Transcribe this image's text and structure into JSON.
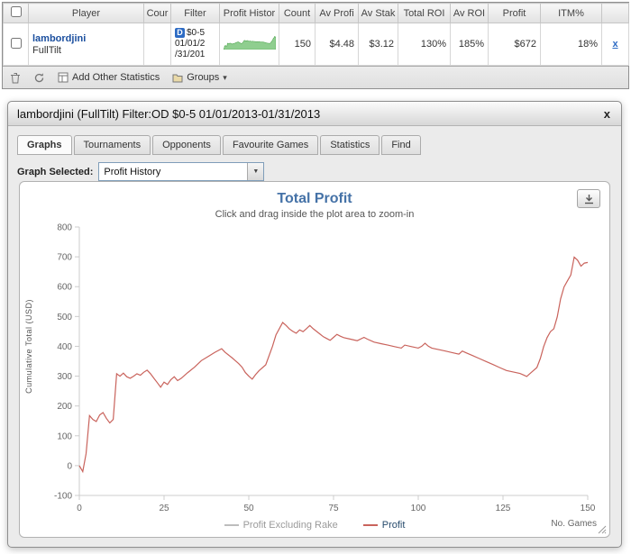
{
  "table": {
    "headers": [
      "",
      "Player",
      "Cour",
      "Filter",
      "Profit Histor",
      "Count",
      "Av Profi",
      "Av Stak",
      "Total ROI",
      "Av ROI",
      "Profit",
      "ITM%",
      ""
    ],
    "row": {
      "player": "lambordjini",
      "site": "FullTilt",
      "filter_badge": "D",
      "filter_line1": "$0-5",
      "filter_line2": "01/01/2",
      "filter_line3": "/31/201",
      "count": "150",
      "av_profit": "$4.48",
      "av_stake": "$3.12",
      "total_roi": "130%",
      "av_roi": "185%",
      "profit": "$672",
      "itm": "18%",
      "remove_label": "x",
      "sparkline_color": "#8fce8f",
      "sparkline_stroke": "#57a957"
    },
    "toolbar": {
      "add_other_statistics": "Add Other Statistics",
      "groups": "Groups",
      "groups_caret": "▾"
    }
  },
  "dialog": {
    "title": "lambordjini (FullTilt) Filter:OD $0-5 01/01/2013-01/31/2013",
    "close_label": "x",
    "tabs": [
      "Graphs",
      "Tournaments",
      "Opponents",
      "Favourite Games",
      "Statistics",
      "Find"
    ],
    "graph_selected_label": "Graph Selected:",
    "graph_selected_value": "Profit History"
  },
  "chart_data": {
    "type": "line",
    "title": "Total Profit",
    "subtitle": "Click and drag inside the plot area to zoom-in",
    "ylabel": "Cumulative Total (USD)",
    "xlabel": "No. Games",
    "xlim": [
      0,
      150
    ],
    "ylim": [
      -100,
      800
    ],
    "xticks": [
      0,
      25,
      50,
      75,
      100,
      125,
      150
    ],
    "yticks": [
      -100,
      0,
      100,
      200,
      300,
      400,
      500,
      600,
      700,
      800
    ],
    "grid": false,
    "legend_position": "bottom",
    "legend": [
      {
        "name": "Profit Excluding Rake",
        "color": "#bdbdbd",
        "label_color": "#9a9a9a",
        "disabled": true
      },
      {
        "name": "Profit",
        "color": "#c9635c",
        "label_color": "#274b6d",
        "disabled": false
      }
    ],
    "series": [
      {
        "name": "Profit",
        "color": "#c9635c",
        "points": [
          [
            0,
            0
          ],
          [
            1,
            -20
          ],
          [
            2,
            40
          ],
          [
            3,
            168
          ],
          [
            4,
            155
          ],
          [
            5,
            148
          ],
          [
            6,
            170
          ],
          [
            7,
            178
          ],
          [
            8,
            158
          ],
          [
            9,
            143
          ],
          [
            10,
            155
          ],
          [
            11,
            308
          ],
          [
            12,
            300
          ],
          [
            13,
            310
          ],
          [
            14,
            298
          ],
          [
            15,
            293
          ],
          [
            16,
            300
          ],
          [
            17,
            308
          ],
          [
            18,
            303
          ],
          [
            19,
            313
          ],
          [
            20,
            320
          ],
          [
            21,
            308
          ],
          [
            22,
            293
          ],
          [
            23,
            278
          ],
          [
            24,
            263
          ],
          [
            25,
            280
          ],
          [
            26,
            272
          ],
          [
            27,
            288
          ],
          [
            28,
            298
          ],
          [
            29,
            285
          ],
          [
            30,
            292
          ],
          [
            32,
            312
          ],
          [
            34,
            330
          ],
          [
            36,
            352
          ],
          [
            38,
            366
          ],
          [
            40,
            380
          ],
          [
            42,
            392
          ],
          [
            43,
            380
          ],
          [
            44,
            371
          ],
          [
            45,
            362
          ],
          [
            46,
            352
          ],
          [
            47,
            342
          ],
          [
            48,
            330
          ],
          [
            49,
            312
          ],
          [
            50,
            300
          ],
          [
            51,
            290
          ],
          [
            52,
            305
          ],
          [
            53,
            318
          ],
          [
            55,
            338
          ],
          [
            57,
            400
          ],
          [
            58,
            438
          ],
          [
            60,
            480
          ],
          [
            61,
            470
          ],
          [
            62,
            458
          ],
          [
            63,
            450
          ],
          [
            64,
            444
          ],
          [
            65,
            455
          ],
          [
            66,
            449
          ],
          [
            67,
            459
          ],
          [
            68,
            470
          ],
          [
            69,
            459
          ],
          [
            70,
            450
          ],
          [
            71,
            441
          ],
          [
            72,
            432
          ],
          [
            73,
            426
          ],
          [
            74,
            420
          ],
          [
            75,
            430
          ],
          [
            76,
            440
          ],
          [
            77,
            434
          ],
          [
            78,
            429
          ],
          [
            80,
            424
          ],
          [
            82,
            419
          ],
          [
            84,
            430
          ],
          [
            85,
            424
          ],
          [
            87,
            414
          ],
          [
            89,
            409
          ],
          [
            91,
            404
          ],
          [
            93,
            399
          ],
          [
            95,
            394
          ],
          [
            96,
            404
          ],
          [
            98,
            399
          ],
          [
            100,
            394
          ],
          [
            101,
            400
          ],
          [
            102,
            410
          ],
          [
            103,
            400
          ],
          [
            104,
            394
          ],
          [
            106,
            389
          ],
          [
            108,
            384
          ],
          [
            110,
            379
          ],
          [
            112,
            374
          ],
          [
            113,
            384
          ],
          [
            114,
            379
          ],
          [
            116,
            369
          ],
          [
            118,
            359
          ],
          [
            120,
            349
          ],
          [
            122,
            339
          ],
          [
            124,
            329
          ],
          [
            126,
            319
          ],
          [
            128,
            314
          ],
          [
            130,
            309
          ],
          [
            131,
            304
          ],
          [
            132,
            299
          ],
          [
            133,
            309
          ],
          [
            134,
            319
          ],
          [
            135,
            329
          ],
          [
            136,
            359
          ],
          [
            137,
            399
          ],
          [
            138,
            429
          ],
          [
            139,
            449
          ],
          [
            140,
            459
          ],
          [
            141,
            499
          ],
          [
            142,
            559
          ],
          [
            143,
            599
          ],
          [
            144,
            619
          ],
          [
            145,
            639
          ],
          [
            146,
            699
          ],
          [
            147,
            689
          ],
          [
            148,
            669
          ],
          [
            149,
            679
          ],
          [
            150,
            681
          ]
        ]
      }
    ]
  }
}
